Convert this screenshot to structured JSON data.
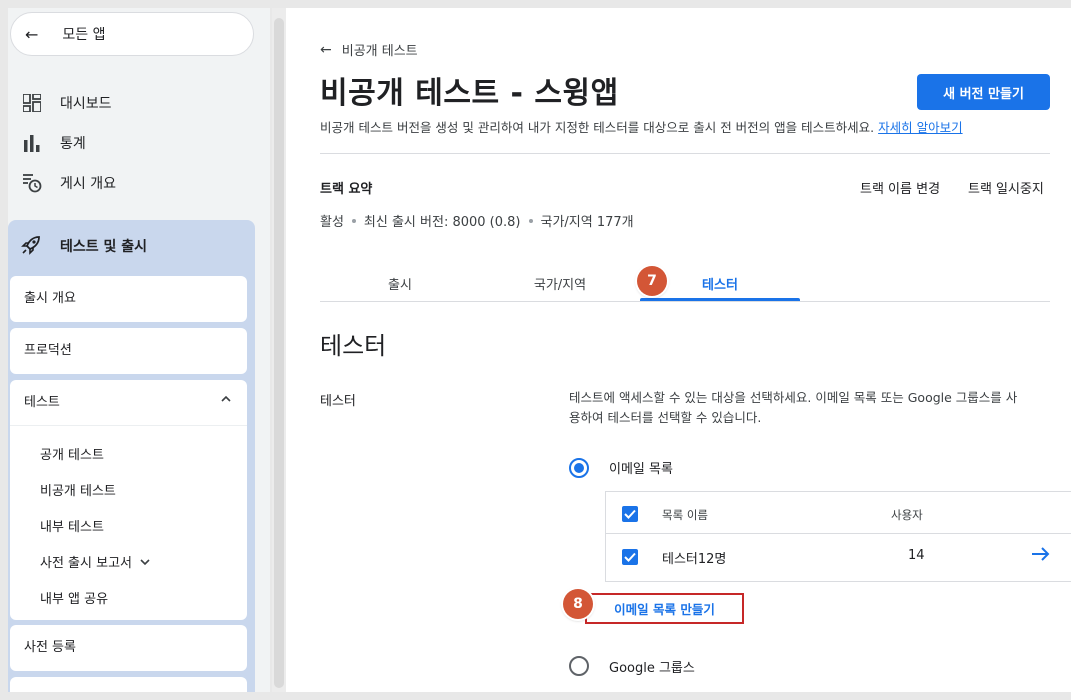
{
  "sidebar": {
    "all_apps": "모든 앱",
    "nav": [
      {
        "label": "대시보드",
        "icon": "dashboard-icon"
      },
      {
        "label": "통계",
        "icon": "bar-chart-icon"
      },
      {
        "label": "게시 개요",
        "icon": "publishing-overview-icon"
      }
    ],
    "section": {
      "label": "테스트 및 출시",
      "icon": "rocket-icon",
      "items": {
        "release_overview": "출시 개요",
        "production": "프로덕션",
        "testing": "테스트",
        "testing_children": [
          "공개 테스트",
          "비공개 테스트",
          "내부 테스트",
          "사전 출시 보고서",
          "내부 앱 공유"
        ],
        "pre_registration": "사전 등록"
      }
    }
  },
  "header": {
    "breadcrumb": "비공개 테스트",
    "title": "비공개 테스트 - 스윙앱",
    "new_release_button": "새 버전 만들기",
    "description": "비공개 테스트 버전을 생성 및 관리하여 내가 지정한 테스터를 대상으로 출시 전 버전의 앱을 테스트하세요.",
    "learn_more": "자세히 알아보기"
  },
  "track": {
    "summary_label": "트랙 요약",
    "rename": "트랙 이름 변경",
    "pause": "트랙 일시중지",
    "status": "활성",
    "latest_release": "최신 출시 버전: 8000 (0.8)",
    "countries": "국가/지역 177개"
  },
  "tabs": [
    {
      "label": "출시"
    },
    {
      "label": "국가/지역"
    },
    {
      "label": "테스터",
      "active": true
    }
  ],
  "badges": {
    "tab_step": "7",
    "create_step": "8"
  },
  "testers": {
    "section_title": "테스터",
    "label": "테스터",
    "description_line1": "테스트에 액세스할 수 있는 대상을 선택하세요. 이메일 목록 또는 Google 그룹스를 사",
    "description_line2": "용하여 테스터를 선택할 수 있습니다.",
    "option_email": "이메일 목록",
    "option_groups": "Google 그룹스",
    "table": {
      "col_name": "목록 이름",
      "col_users": "사용자",
      "rows": [
        {
          "name": "테스터12명",
          "users": "14"
        }
      ]
    },
    "create_list": "이메일 목록 만들기"
  },
  "colors": {
    "accent": "#1a73e8",
    "badge": "#d35636",
    "highlight_border": "#c62828"
  }
}
